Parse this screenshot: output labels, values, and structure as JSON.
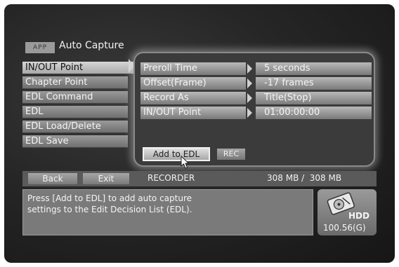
{
  "header": {
    "app_tag": "APP",
    "title": "Auto Capture"
  },
  "menu": {
    "items": [
      {
        "label": "IN/OUT Point",
        "active": true
      },
      {
        "label": "Chapter Point",
        "active": false
      },
      {
        "label": "EDL Command",
        "active": false
      },
      {
        "label": "EDL",
        "active": false
      },
      {
        "label": "EDL Load/Delete",
        "active": false
      },
      {
        "label": "EDL Save",
        "active": false
      }
    ]
  },
  "settings": {
    "rows": [
      {
        "label": "Preroll Time",
        "value": "5 seconds"
      },
      {
        "label": "Offset(Frame)",
        "value": "-17 frames"
      },
      {
        "label": "Record As",
        "value": "Title(Stop)"
      },
      {
        "label": "IN/OUT Point",
        "value": "01:00:00:00"
      }
    ],
    "add_button": "Add to EDL",
    "rec_button": "REC"
  },
  "status": {
    "back_label": "Back",
    "exit_label": "Exit",
    "device": "RECORDER",
    "capacity": "308 MB /  308 MB"
  },
  "help": {
    "line1": "Press [Add to EDL] to add auto capture",
    "line2": "settings to the Edit Decision List (EDL)."
  },
  "hdd": {
    "label": "HDD",
    "value": "100.56(G)",
    "icon": "hdd-icon"
  }
}
